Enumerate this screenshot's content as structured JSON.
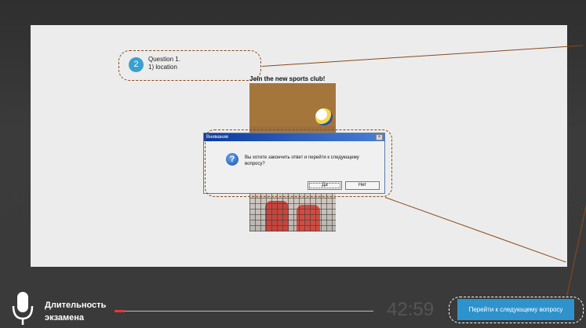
{
  "question": {
    "number": "2",
    "line1": "Question 1.",
    "line2": "1) location"
  },
  "task": {
    "title": "Join the new sports club!"
  },
  "dialog": {
    "title": "Внимание",
    "close_glyph": "×",
    "message": "Вы хотите закончить ответ и перейти к следующему вопросу?",
    "yes_label": "Да",
    "no_label": "Нет"
  },
  "footer": {
    "duration_line1": "Длительность",
    "duration_line2": "экзамена",
    "timer": "42:59",
    "progress": 0.04,
    "next_button": "Перейти к следующему вопросу"
  },
  "colors": {
    "accent": "#2e93cc",
    "callout": "#8a4a1c",
    "progress": "#e03a3a"
  }
}
